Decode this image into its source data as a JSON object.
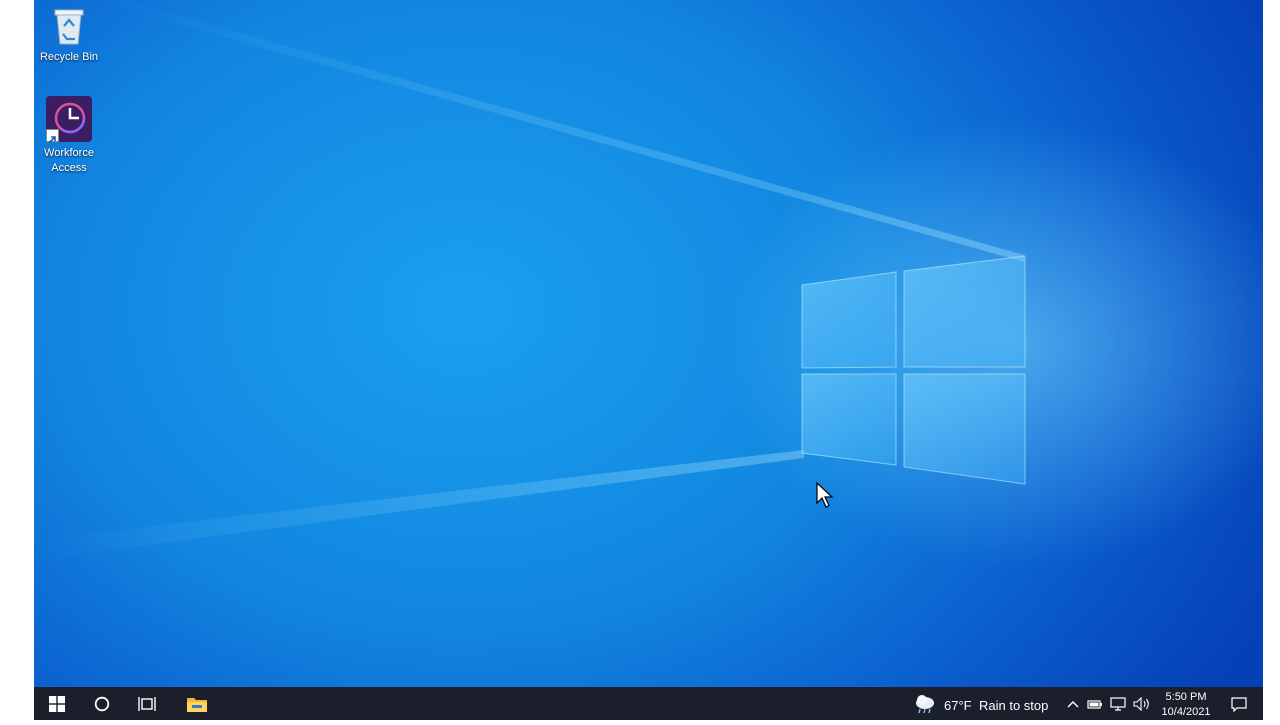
{
  "desktop": {
    "icons": [
      {
        "label": "Recycle Bin",
        "icon": "recycle-bin-icon"
      },
      {
        "label": "Workforce\nAccess",
        "label_line1": "Workforce",
        "label_line2": "Access",
        "icon": "workforce-access-icon"
      }
    ]
  },
  "taskbar": {
    "start_icon": "windows-logo-icon",
    "search_icon": "cortana-circle-icon",
    "taskview_icon": "task-view-icon",
    "pinned": [
      {
        "icon": "file-explorer-icon"
      }
    ],
    "weather": {
      "icon": "rain-cloud-icon",
      "temperature": "67°F",
      "condition": "Rain to stop"
    },
    "tray_icons": [
      "chevron-up-icon",
      "battery-icon",
      "network-icon",
      "volume-icon"
    ],
    "clock": {
      "time": "5:50 PM",
      "date": "10/4/2021"
    },
    "notification_icon": "action-center-icon"
  },
  "colors": {
    "taskbar": "#1a1f2b",
    "wallpaper_light": "#1aa0ee",
    "wallpaper_dark": "#0540b6",
    "workforce_tile": "#3a1d63",
    "workforce_ring": "#e0509a"
  }
}
